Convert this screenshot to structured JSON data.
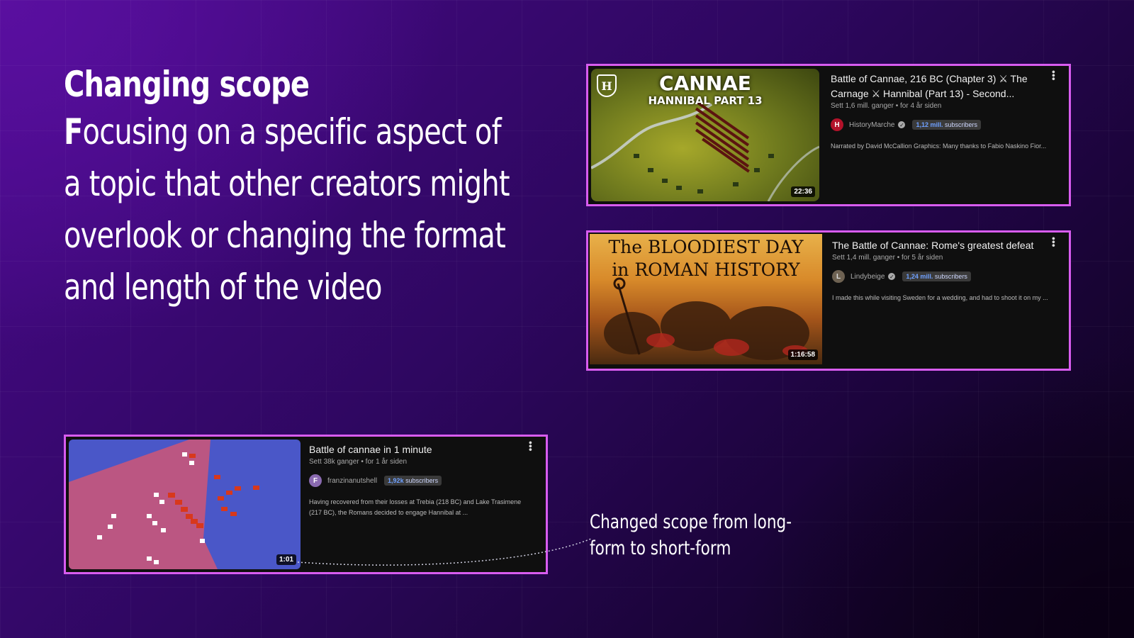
{
  "slide": {
    "title": "Changing scope",
    "body_first_letter": "F",
    "body_rest": "ocusing on a specific aspect of a topic that other creators might overlook or changing the format and length of the video",
    "annotation": "Changed scope from long-form to short-form"
  },
  "videos": [
    {
      "id": "cannae-historymarche",
      "thumb_title": "CANNAE",
      "thumb_subtitle": "HANNIBAL PART 13",
      "thumb_logo": "H",
      "duration": "22:36",
      "title": "Battle of Cannae, 216 BC (Chapter 3) ⚔ The Carnage ⚔ Hannibal (Part 13) - Second...",
      "meta": "Sett 1,6 mill. ganger • for 4 år siden",
      "channel": "HistoryMarche",
      "subs_value": "1,12 mill.",
      "subs_label": "subscribers",
      "description": "Narrated by David McCallion Graphics: Many thanks to Fabio Naskino Fior...",
      "avatar_color": "#b3122a"
    },
    {
      "id": "cannae-lindybeige",
      "thumb_line1": "The BLOODIEST DAY",
      "thumb_line2": "in ROMAN HISTORY",
      "duration": "1:16:58",
      "title": "The Battle of Cannae: Rome's greatest defeat",
      "meta": "Sett 1,4 mill. ganger • for 5 år siden",
      "channel": "Lindybeige",
      "subs_value": "1,24 mill.",
      "subs_label": "subscribers",
      "description": "I made this while visiting Sweden for a wedding, and had to shoot it on my ...",
      "avatar_color": "#6e6252"
    },
    {
      "id": "cannae-1-minute",
      "duration": "1:01",
      "title": "Battle of cannae in 1 minute",
      "meta": "Sett 38k ganger • for 1 år siden",
      "channel": "franzinanutshell",
      "subs_value": "1,92k",
      "subs_label": "subscribers",
      "description": "Having recovered from their losses at Trebia (218 BC) and Lake Trasimene (217 BC), the Romans decided to engage Hannibal at ...",
      "avatar_color": "#8a6ab0"
    }
  ],
  "colors": {
    "card_border": "#d85cf0",
    "card_bg": "#0f0f0f",
    "subs_highlight": "#6fa0ff"
  },
  "icons": {
    "more": "more-vertical-icon",
    "verified": "verified-check-icon"
  }
}
